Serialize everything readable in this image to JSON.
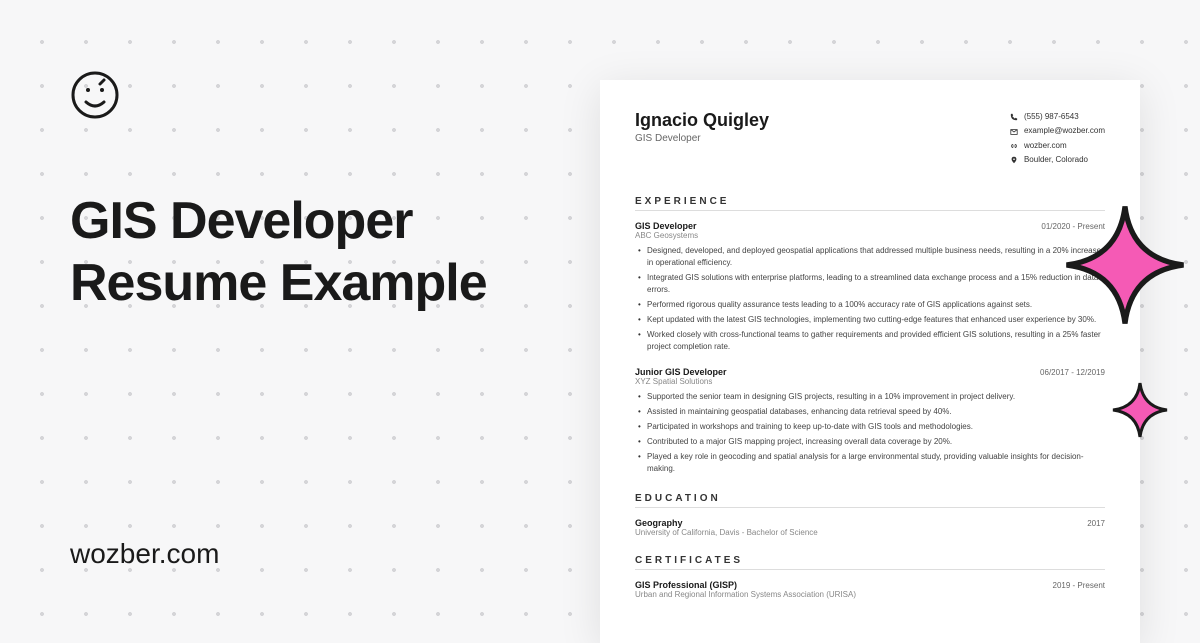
{
  "title_line1": "GIS Developer",
  "title_line2": "Resume Example",
  "brand": "wozber.com",
  "resume": {
    "name": "Ignacio Quigley",
    "role": "GIS Developer",
    "contact": {
      "phone": "(555) 987-6543",
      "email": "example@wozber.com",
      "website": "wozber.com",
      "location": "Boulder, Colorado"
    },
    "sections": {
      "experience_label": "EXPERIENCE",
      "education_label": "EDUCATION",
      "certificates_label": "CERTIFICATES"
    },
    "jobs": [
      {
        "title": "GIS Developer",
        "company": "ABC Geosystems",
        "dates": "01/2020 - Present",
        "bullets": [
          "Designed, developed, and deployed geospatial applications that addressed multiple business needs, resulting in a 20% increase in operational efficiency.",
          "Integrated GIS solutions with enterprise platforms, leading to a streamlined data exchange process and a 15% reduction in data errors.",
          "Performed rigorous quality assurance tests leading to a 100% accuracy rate of GIS applications against sets.",
          "Kept updated with the latest GIS technologies, implementing two cutting-edge features that enhanced user experience by 30%.",
          "Worked closely with cross-functional teams to gather requirements and provided efficient GIS solutions, resulting in a 25% faster project completion rate."
        ]
      },
      {
        "title": "Junior GIS Developer",
        "company": "XYZ Spatial Solutions",
        "dates": "06/2017 - 12/2019",
        "bullets": [
          "Supported the senior team in designing GIS projects, resulting in a 10% improvement in project delivery.",
          "Assisted in maintaining geospatial databases, enhancing data retrieval speed by 40%.",
          "Participated in workshops and training to keep up-to-date with GIS tools and methodologies.",
          "Contributed to a major GIS mapping project, increasing overall data coverage by 20%.",
          "Played a key role in geocoding and spatial analysis for a large environmental study, providing valuable insights for decision-making."
        ]
      }
    ],
    "education": {
      "degree": "Geography",
      "school": "University of California, Davis - Bachelor of Science",
      "year": "2017"
    },
    "certificates": [
      {
        "name": "GIS Professional (GISP)",
        "org": "Urban and Regional Information Systems Association (URISA)",
        "dates": "2019 - Present"
      }
    ]
  }
}
